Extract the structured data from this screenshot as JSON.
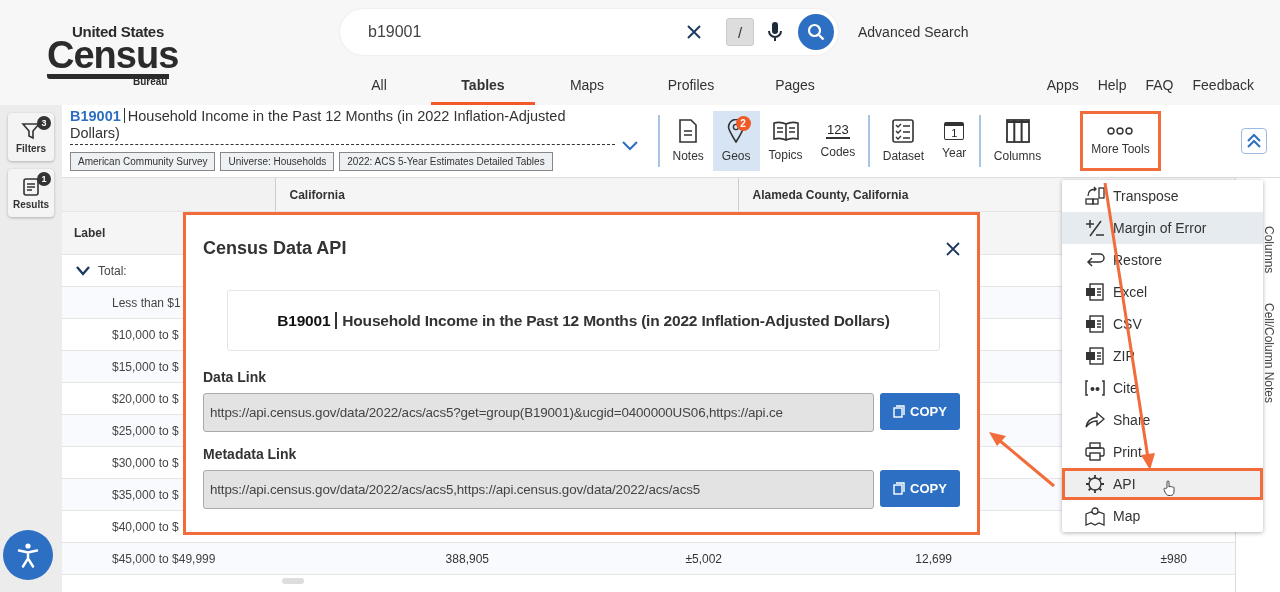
{
  "logo": {
    "line1": "United States",
    "line2": "Census",
    "line3": "Bureau"
  },
  "search": {
    "value": "b19001",
    "shortcut": "/",
    "advanced": "Advanced Search"
  },
  "nav": [
    {
      "label": "All",
      "selected": false
    },
    {
      "label": "Tables",
      "selected": true
    },
    {
      "label": "Maps",
      "selected": false
    },
    {
      "label": "Profiles",
      "selected": false
    },
    {
      "label": "Pages",
      "selected": false
    }
  ],
  "utility_links": [
    "Apps",
    "Help",
    "FAQ",
    "Feedback"
  ],
  "sidebar": [
    {
      "label": "Filters",
      "badge": "3",
      "kind": "filter"
    },
    {
      "label": "Results",
      "badge": "1",
      "kind": "results"
    }
  ],
  "table_header": {
    "code": "B19001",
    "title": "Household Income in the Past 12 Months (in 2022 Inflation-Adjusted Dollars)",
    "tags": [
      "American Community Survey",
      "Universe: Households",
      "2022: ACS 5-Year Estimates Detailed Tables"
    ]
  },
  "toolbar_groups": [
    [
      {
        "label": "Notes",
        "kind": "notes",
        "selected": false,
        "highlighted": false
      },
      {
        "label": "Geos",
        "kind": "geos",
        "selected": true,
        "highlighted": false,
        "badge": "2"
      },
      {
        "label": "Topics",
        "kind": "topics",
        "selected": false,
        "highlighted": false
      },
      {
        "label": "Codes",
        "kind": "codes",
        "selected": false,
        "highlighted": false,
        "icon_text": "123"
      }
    ],
    [
      {
        "label": "Dataset",
        "kind": "dataset",
        "selected": false,
        "highlighted": false
      },
      {
        "label": "Year",
        "kind": "year",
        "selected": false,
        "highlighted": false,
        "icon_text": "1"
      }
    ],
    [
      {
        "label": "Columns",
        "kind": "columns",
        "selected": false,
        "highlighted": false
      },
      {
        "label": "More Tools",
        "kind": "more",
        "selected": false,
        "highlighted": true
      }
    ]
  ],
  "table": {
    "geographies": [
      "California",
      "Alameda County, California"
    ],
    "label_heading": "Label",
    "rows": [
      {
        "label": "Total:",
        "kind": "group",
        "expanded": true
      },
      {
        "label": "Less than $1",
        "kind": "item"
      },
      {
        "label": "$10,000 to $",
        "kind": "item"
      },
      {
        "label": "$15,000 to $",
        "kind": "item"
      },
      {
        "label": "$20,000 to $",
        "kind": "item"
      },
      {
        "label": "$25,000 to $",
        "kind": "item"
      },
      {
        "label": "$30,000 to $",
        "kind": "item"
      },
      {
        "label": "$35,000 to $",
        "kind": "item"
      },
      {
        "label": "$40,000 to $",
        "kind": "item"
      },
      {
        "label": "$45,000 to $49,999",
        "kind": "item",
        "values": [
          "388,905",
          "±5,002",
          "12,699",
          "±980"
        ]
      }
    ]
  },
  "side_tabs": [
    "Columns",
    "Cell/Column Notes"
  ],
  "modal": {
    "title": "Census Data API",
    "code": "B19001",
    "table_title": "Household Income in the Past 12 Months (in 2022 Inflation-Adjusted Dollars)",
    "links": [
      {
        "label": "Data Link",
        "value": "https://api.census.gov/data/2022/acs/acs5?get=group(B19001)&ucgid=0400000US06,https://api.ce",
        "button": "COPY"
      },
      {
        "label": "Metadata Link",
        "value": "https://api.census.gov/data/2022/acs/acs5,https://api.census.gov/data/2022/acs/acs5",
        "button": "COPY"
      }
    ]
  },
  "more_tools_menu": [
    {
      "label": "Transpose",
      "kind": "transpose",
      "hovered": false,
      "highlighted": false
    },
    {
      "label": "Margin of Error",
      "kind": "moe",
      "hovered": true,
      "highlighted": false
    },
    {
      "label": "Restore",
      "kind": "restore",
      "hovered": false,
      "highlighted": false
    },
    {
      "label": "Excel",
      "kind": "file",
      "hovered": false,
      "highlighted": false
    },
    {
      "label": "CSV",
      "kind": "file",
      "hovered": false,
      "highlighted": false
    },
    {
      "label": "ZIP",
      "kind": "file",
      "hovered": false,
      "highlighted": false
    },
    {
      "label": "Cite",
      "kind": "cite",
      "hovered": false,
      "highlighted": false
    },
    {
      "label": "Share",
      "kind": "share",
      "hovered": false,
      "highlighted": false
    },
    {
      "label": "Print",
      "kind": "print",
      "hovered": false,
      "highlighted": false
    },
    {
      "label": "API",
      "kind": "api",
      "hovered": false,
      "highlighted": true
    },
    {
      "label": "Map",
      "kind": "map",
      "hovered": false,
      "highlighted": false
    }
  ]
}
